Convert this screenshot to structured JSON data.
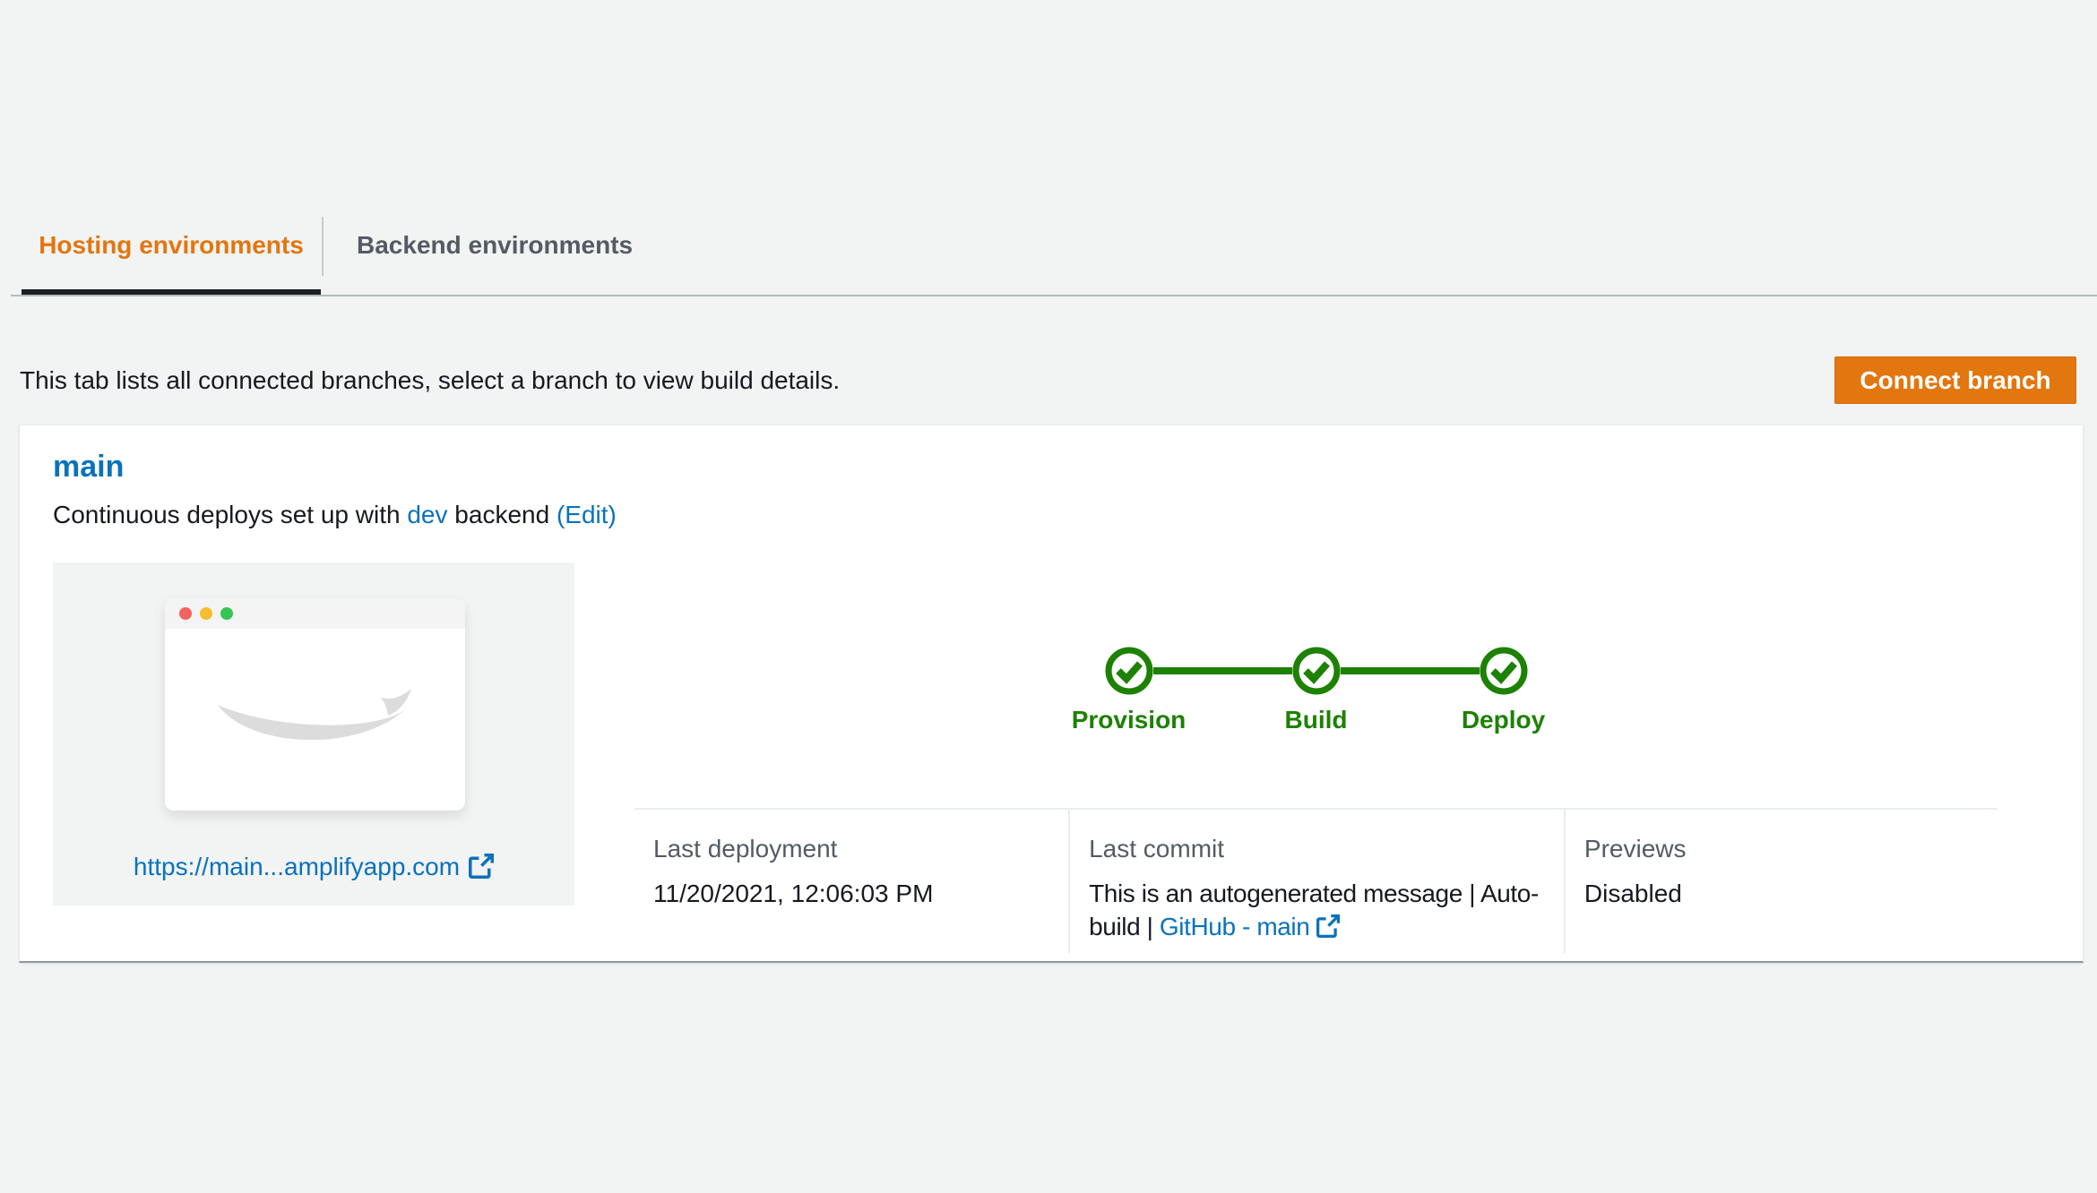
{
  "tabs": {
    "hosting": "Hosting environments",
    "backend": "Backend environments"
  },
  "toolbar": {
    "description": "This tab lists all connected branches, select a branch to view build details.",
    "connect_branch_label": "Connect branch"
  },
  "branch": {
    "name": "main",
    "subtitle_prefix": "Continuous deploys set up with",
    "backend_link": "dev",
    "subtitle_middle": "backend",
    "edit_link": "(Edit)",
    "url": "https://main...amplifyapp.com"
  },
  "pipeline": {
    "steps": [
      {
        "label": "Provision",
        "status": "complete"
      },
      {
        "label": "Build",
        "status": "complete"
      },
      {
        "label": "Deploy",
        "status": "complete"
      }
    ]
  },
  "details": {
    "deployment": {
      "label": "Last deployment",
      "value": "11/20/2021, 12:06:03 PM"
    },
    "commit": {
      "label": "Last commit",
      "line1": "This is an autogenerated message | Auto-",
      "line2_prefix": "build | ",
      "link": "GitHub - main"
    },
    "previews": {
      "label": "Previews",
      "value": "Disabled"
    }
  },
  "colors": {
    "accent_orange": "#e2760f",
    "link_blue": "#0a72bb",
    "success_green": "#1d8102",
    "text_dark": "#16191f",
    "text_gray": "#545b64",
    "page_background": "#f2f3f3"
  }
}
